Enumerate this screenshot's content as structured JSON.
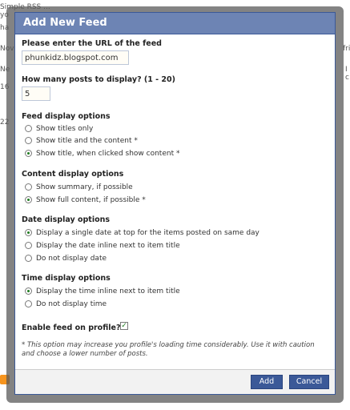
{
  "background": {
    "top_text": "Simple RSS ...",
    "frag_1": "yo",
    "frag_2": "ha",
    "frag_3": "Nov",
    "frag_4": "Ne",
    "frag_5": "16",
    "frag_6": "22",
    "right_1": "fri",
    "right_2": "I",
    "right_3": "c"
  },
  "dialog": {
    "title": "Add New Feed",
    "url_label": "Please enter the URL of the feed",
    "url_value": "phunkidz.blogspot.com",
    "posts_label": "How many posts to display? (1 - 20)",
    "posts_value": "5",
    "feed_display": {
      "title": "Feed display options",
      "options": [
        "Show titles only",
        "Show title and the content *",
        "Show title, when clicked show content *"
      ],
      "selected": 2
    },
    "content_display": {
      "title": "Content display options",
      "options": [
        "Show summary, if possible",
        "Show full content, if possible *"
      ],
      "selected": 1
    },
    "date_display": {
      "title": "Date display options",
      "options": [
        "Display a single date at top for the items posted on same day",
        "Display the date inline next to item title",
        "Do not display date"
      ],
      "selected": 0
    },
    "time_display": {
      "title": "Time display options",
      "options": [
        "Display the time inline next to item title",
        "Do not display time"
      ],
      "selected": 0
    },
    "enable_label": "Enable feed on profile?",
    "enable_checked": true,
    "note": "* This option may increase you profile's loading time considerably. Use it with caution and choose a lower number of posts.",
    "add_label": "Add",
    "cancel_label": "Cancel"
  }
}
